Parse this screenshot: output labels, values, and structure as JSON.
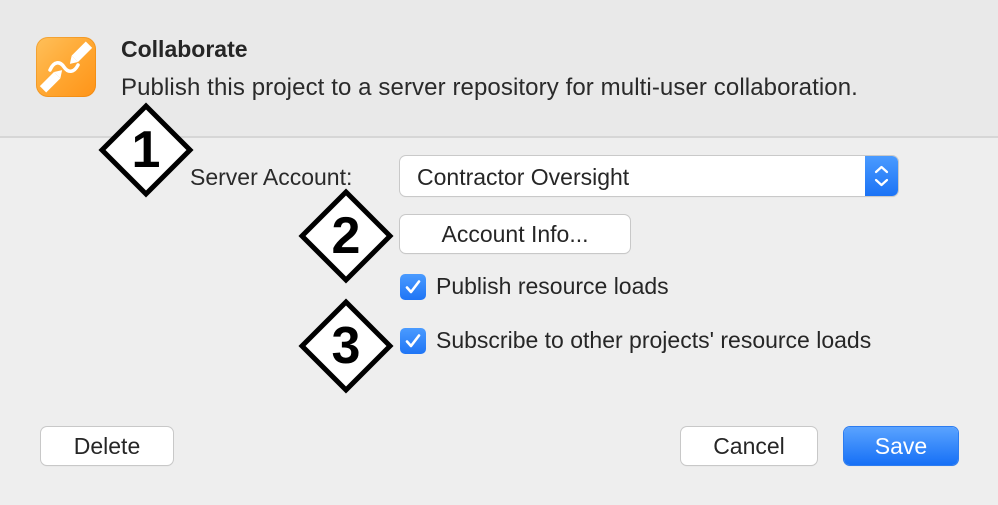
{
  "dialog": {
    "app_icon": "collaborate-app-icon",
    "title": "Collaborate",
    "subtitle": "Publish this project to a server repository for multi-user collaboration."
  },
  "form": {
    "server_account_label": "Server Account:",
    "server_account_value": "Contractor Oversight",
    "account_info_button": "Account Info...",
    "checkboxes": [
      {
        "label": "Publish resource loads",
        "checked": true
      },
      {
        "label": "Subscribe to other projects' resource loads",
        "checked": true
      }
    ]
  },
  "callouts": [
    "1",
    "2",
    "3"
  ],
  "footer": {
    "delete_button": "Delete",
    "cancel_button": "Cancel",
    "save_button": "Save"
  },
  "colors": {
    "accent": "#1b73f5",
    "icon_orange": "#ffa630",
    "background": "#ececec"
  }
}
